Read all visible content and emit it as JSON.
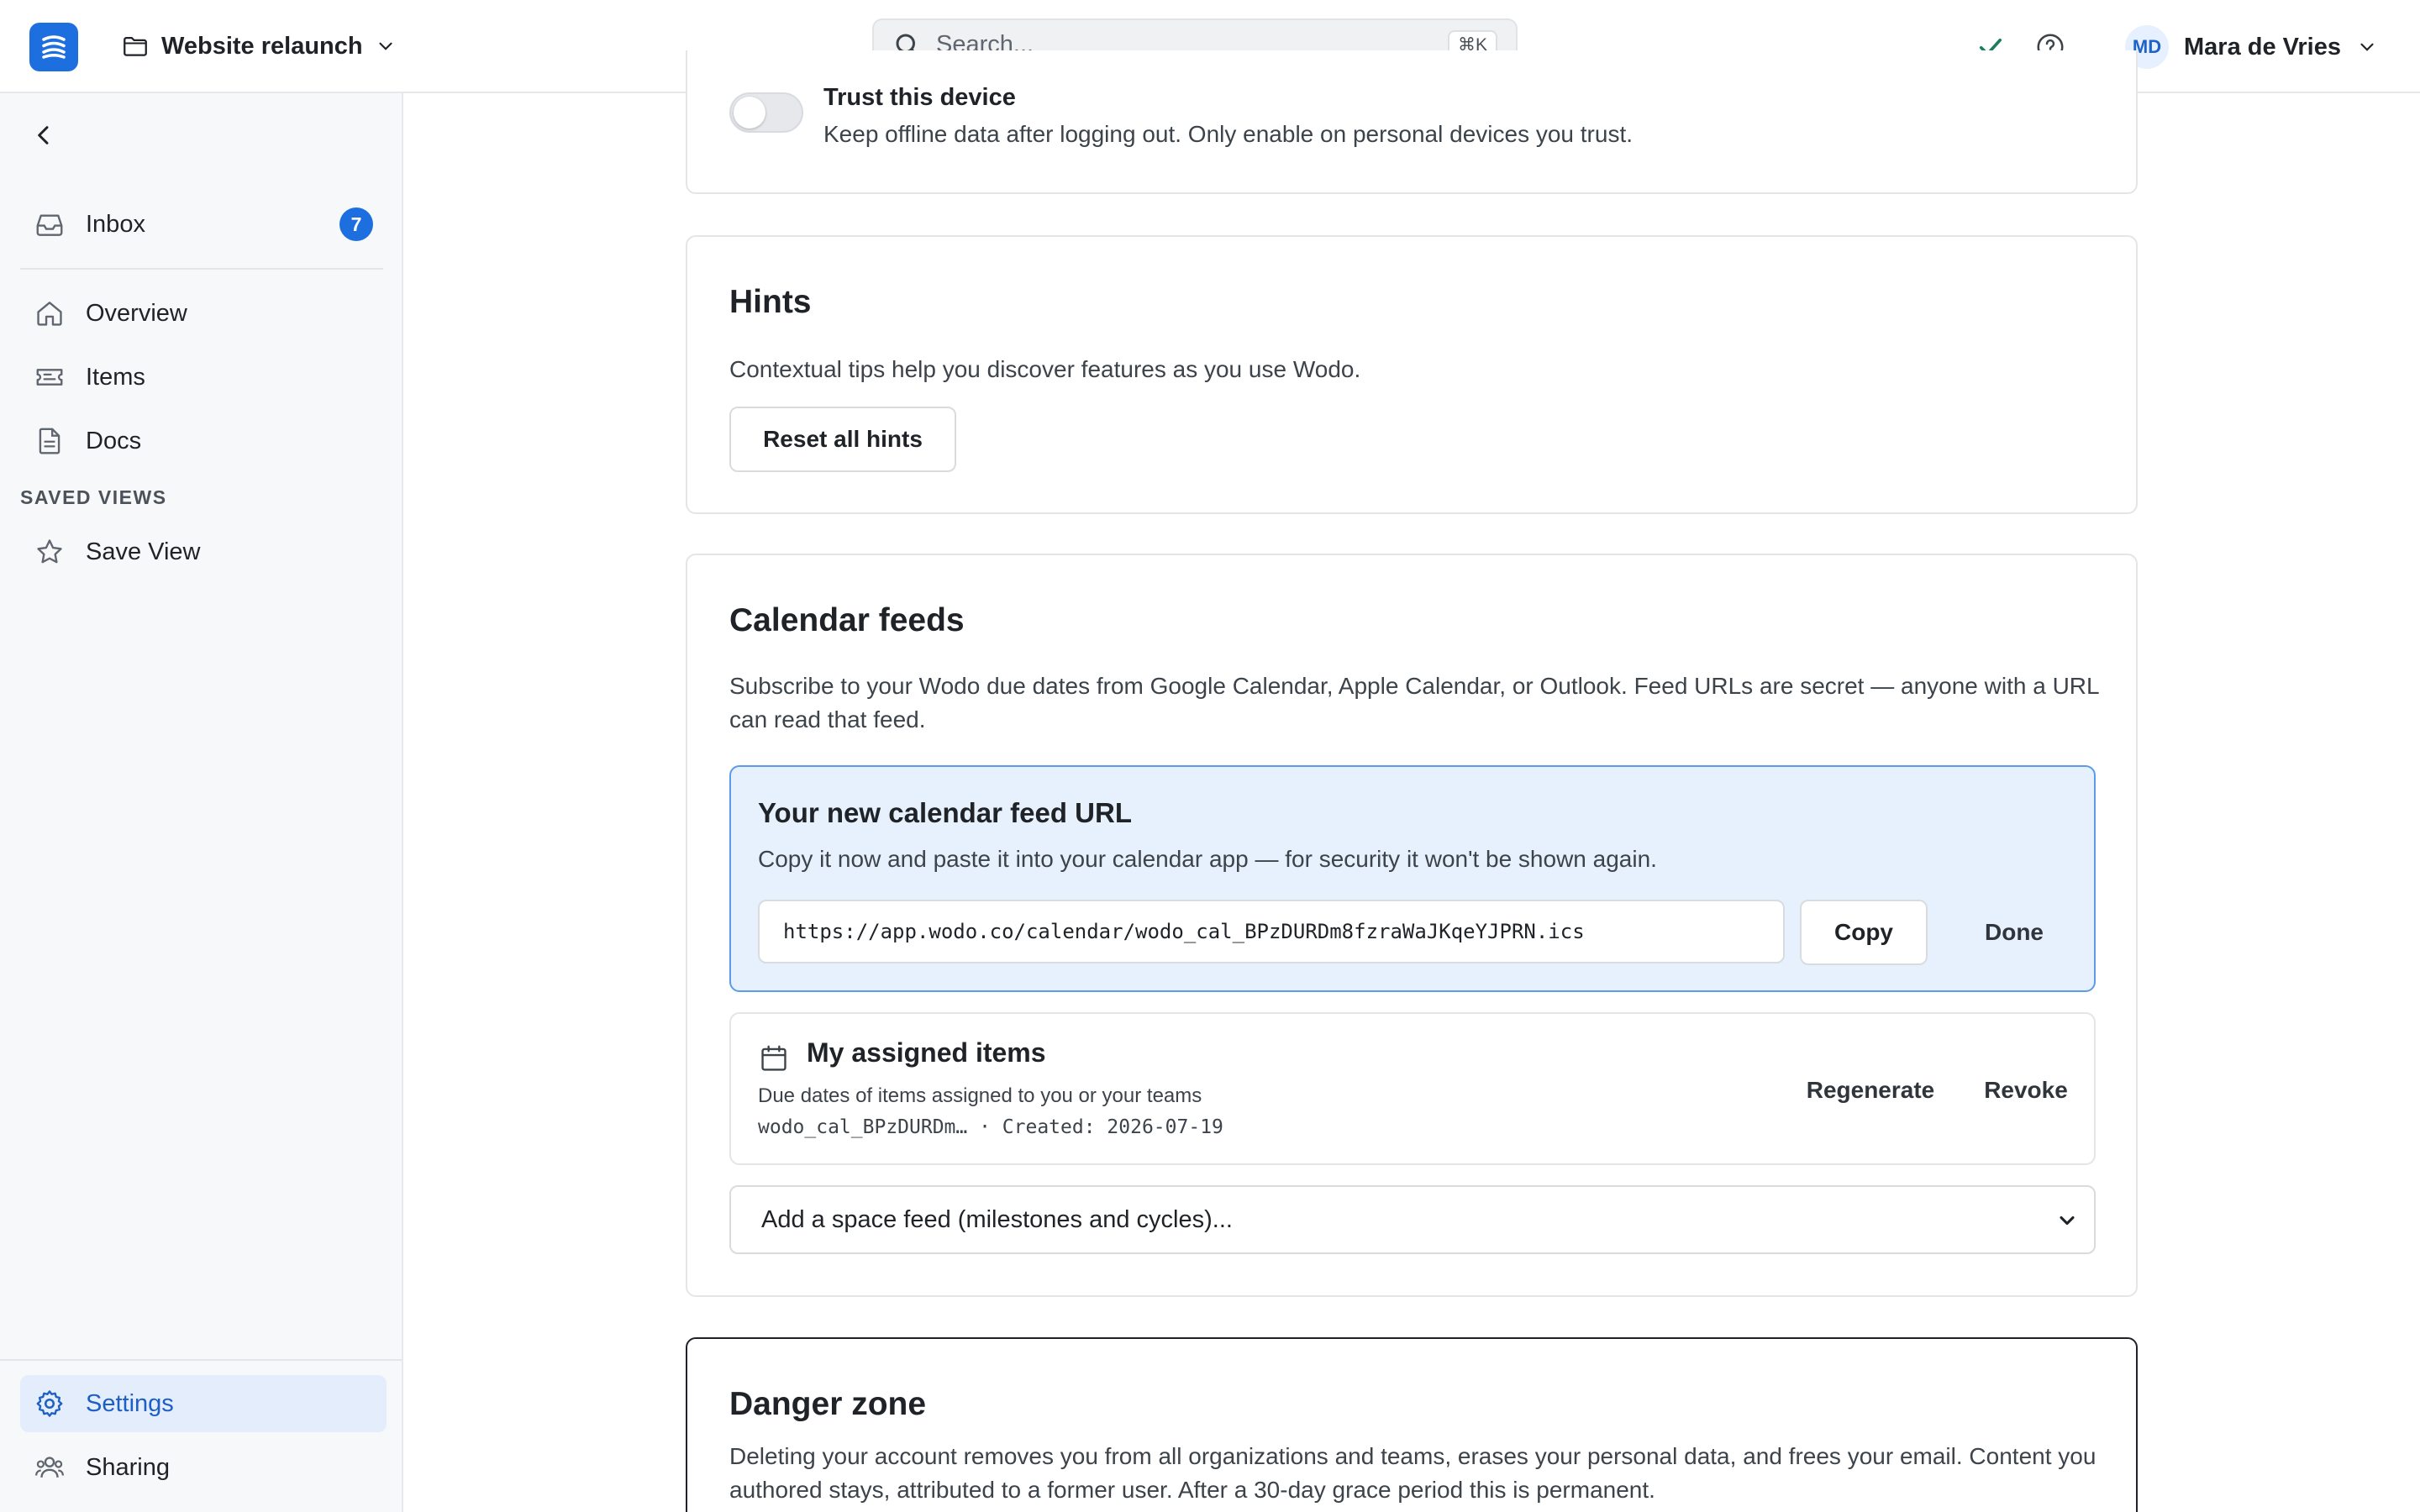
{
  "header": {
    "project_name": "Website relaunch",
    "search_placeholder": "Search...",
    "search_shortcut": "⌘K",
    "user_initials": "MD",
    "user_name": "Mara de Vries",
    "progress_fraction": 0.128
  },
  "sidebar": {
    "items": [
      {
        "label": "Inbox",
        "badge": "7"
      },
      {
        "label": "Overview"
      },
      {
        "label": "Items"
      },
      {
        "label": "Docs"
      }
    ],
    "saved_views_label": "SAVED VIEWS",
    "save_view_label": "Save View",
    "bottom": [
      {
        "label": "Settings",
        "active": true
      },
      {
        "label": "Sharing"
      }
    ]
  },
  "trust": {
    "title": "Trust this device",
    "description": "Keep offline data after logging out. Only enable on personal devices you trust."
  },
  "hints": {
    "title": "Hints",
    "description": "Contextual tips help you discover features as you use Wodo.",
    "reset_label": "Reset all hints"
  },
  "calendar": {
    "title": "Calendar feeds",
    "description": "Subscribe to your Wodo due dates from Google Calendar, Apple Calendar, or Outlook. Feed URLs are secret — anyone with a URL can read that feed.",
    "new_url_title": "Your new calendar feed URL",
    "new_url_sub": "Copy it now and paste it into your calendar app — for security it won't be shown again.",
    "url_value": "https://app.wodo.co/calendar/wodo_cal_BPzDURDm8fzraWaJKqeYJPRN.ics",
    "copy_label": "Copy",
    "done_label": "Done",
    "feed_name": "My assigned items",
    "feed_desc": "Due dates of items assigned to you or your teams",
    "feed_meta": "wodo_cal_BPzDURDm… · Created: 2026-07-19",
    "regenerate_label": "Regenerate",
    "revoke_label": "Revoke",
    "add_feed_label": "Add a space feed (milestones and cycles)..."
  },
  "danger": {
    "title": "Danger zone",
    "description": "Deleting your account removes you from all organizations and teams, erases your personal data, and frees your email. Content you authored stays, attributed to a former user. After a 30-day grace period this is permanent."
  },
  "colors": {
    "accent": "#1d6fe0",
    "success": "#1a7f5a",
    "info_bg": "#e6f1fd"
  }
}
